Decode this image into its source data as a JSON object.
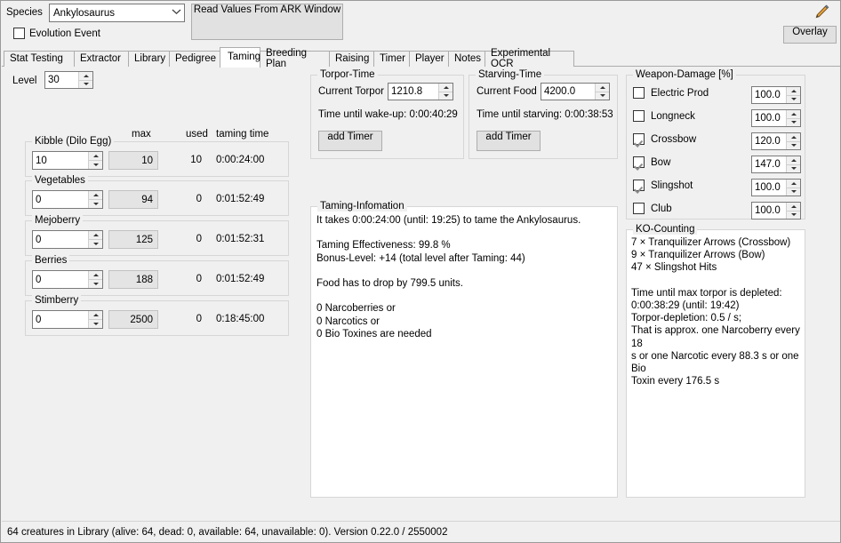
{
  "header": {
    "species_label": "Species",
    "species_value": "Ankylosaurus",
    "dropdown_icon": "chevron-down-icon",
    "evolution_event_label": "Evolution Event",
    "evolution_event_checked": false,
    "read_values_button": "Read Values From ARK Window",
    "overlay_button": "Overlay",
    "pencil_icon": "pencil-icon"
  },
  "tabs": [
    {
      "label": "Stat Testing",
      "active": false
    },
    {
      "label": "Extractor",
      "active": false
    },
    {
      "label": "Library",
      "active": false
    },
    {
      "label": "Pedigree",
      "active": false
    },
    {
      "label": "Taming",
      "active": true
    },
    {
      "label": "Breeding Plan",
      "active": false
    },
    {
      "label": "Raising",
      "active": false
    },
    {
      "label": "Timer",
      "active": false
    },
    {
      "label": "Player",
      "active": false
    },
    {
      "label": "Notes",
      "active": false
    },
    {
      "label": "Experimental OCR",
      "active": false
    }
  ],
  "taming": {
    "level_label": "Level",
    "level_value": "30",
    "columns": {
      "max": "max",
      "used": "used",
      "taming_time": "taming time"
    },
    "foods": [
      {
        "name": "Kibble (Dilo Egg)",
        "amount": "10",
        "max": "10",
        "used": "10",
        "time": "0:00:24:00"
      },
      {
        "name": "Vegetables",
        "amount": "0",
        "max": "94",
        "used": "0",
        "time": "0:01:52:49"
      },
      {
        "name": "Mejoberry",
        "amount": "0",
        "max": "125",
        "used": "0",
        "time": "0:01:52:31"
      },
      {
        "name": "Berries",
        "amount": "0",
        "max": "188",
        "used": "0",
        "time": "0:01:52:49"
      },
      {
        "name": "Stimberry",
        "amount": "0",
        "max": "2500",
        "used": "0",
        "time": "0:18:45:00"
      }
    ]
  },
  "torpor": {
    "group_title": "Torpor-Time",
    "current_label": "Current Torpor",
    "current_value": "1210.8",
    "wakeup_text": "Time until wake-up: 0:00:40:29",
    "add_timer_button": "add Timer"
  },
  "starving": {
    "group_title": "Starving-Time",
    "current_label": "Current Food",
    "current_value": "4200.0",
    "starving_text": "Time until starving: 0:00:38:53",
    "add_timer_button": "add Timer"
  },
  "taming_information": {
    "group_title": "Taming-Infomation",
    "text": "It takes 0:00:24:00 (until: 19:25) to tame the Ankylosaurus.\n\nTaming Effectiveness: 99.8 %\nBonus-Level: +14 (total level after Taming: 44)\n\nFood has to drop by 799.5 units.\n\n0 Narcoberries or\n0 Narcotics or\n0 Bio Toxines are needed"
  },
  "weapon_damage": {
    "group_title": "Weapon-Damage [%]",
    "weapons": [
      {
        "name": "Electric Prod",
        "checked": false,
        "value": "100.0"
      },
      {
        "name": "Longneck",
        "checked": false,
        "value": "100.0"
      },
      {
        "name": "Crossbow",
        "checked": true,
        "value": "120.0"
      },
      {
        "name": "Bow",
        "checked": true,
        "value": "147.0"
      },
      {
        "name": "Slingshot",
        "checked": true,
        "value": "100.0"
      },
      {
        "name": "Club",
        "checked": false,
        "value": "100.0"
      }
    ]
  },
  "ko_counting": {
    "group_title": "KO-Counting",
    "text": "7 × Tranquilizer Arrows (Crossbow)\n9 × Tranquilizer Arrows (Bow)\n47 × Slingshot Hits\n\nTime until max torpor is depleted:\n0:00:38:29 (until: 19:42)\nTorpor-depletion: 0.5 / s;\nThat is approx. one Narcoberry every 18\ns or one Narcotic every 88.3 s or one Bio\nToxin every 176.5 s"
  },
  "statusbar": {
    "text": "64 creatures in Library (alive: 64, dead: 0, available: 64, unavailable: 0). Version 0.22.0 / 2550002"
  },
  "colors": {
    "window_bg": "#f0f0f0",
    "field_bg": "#ffffff",
    "readonly_bg": "#e4e4e4",
    "button_bg": "#e1e1e1",
    "border": "#acacac"
  }
}
